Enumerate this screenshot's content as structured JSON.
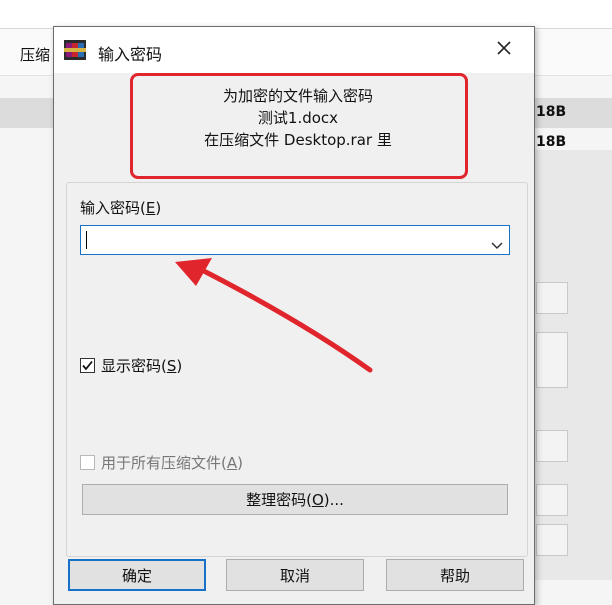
{
  "background": {
    "header_text": "压缩",
    "size_1": "18B",
    "size_2": "18B"
  },
  "dialog": {
    "title": "输入密码",
    "close_glyph": "✕",
    "info_line1": "为加密的文件输入密码",
    "info_line2": "测试1.docx",
    "info_line3": "在压缩文件 Desktop.rar 里",
    "password_label": "输入密码(",
    "password_hotkey": "E",
    "password_label_end": ")",
    "password_value": "",
    "show_password_label": "显示密码(",
    "show_password_hotkey": "S",
    "show_password_end": ")",
    "show_password_checked": true,
    "use_all_label": "用于所有压缩文件(",
    "use_all_hotkey": "A",
    "use_all_end": ")",
    "use_all_checked": false,
    "organize_label": "整理密码(",
    "organize_hotkey": "O",
    "organize_end": ")...",
    "ok_label": "确定",
    "cancel_label": "取消",
    "help_label": "帮助"
  },
  "colors": {
    "highlight": "#e0262c",
    "accent": "#1671c7"
  },
  "icons": {
    "app": "winrar-icon",
    "close": "close-icon",
    "dropdown": "chevron-down-icon",
    "check": "checkmark-icon"
  }
}
